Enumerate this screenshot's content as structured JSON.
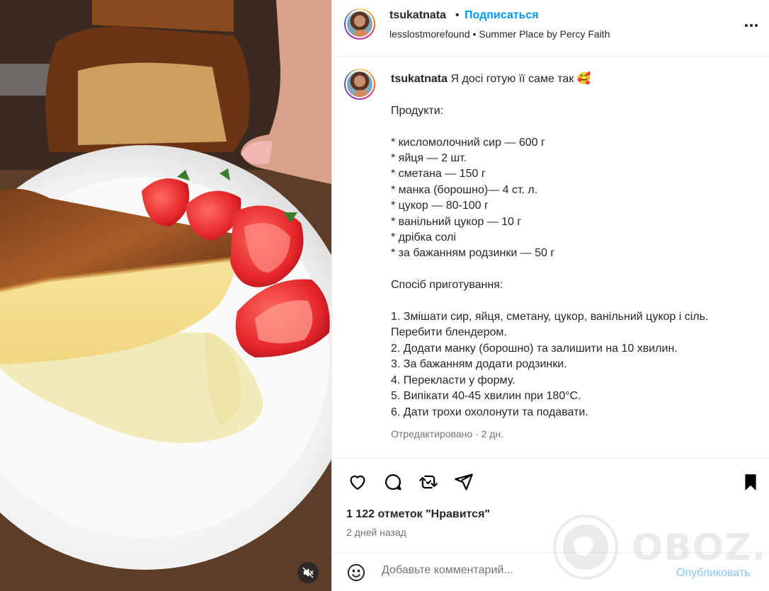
{
  "post": {
    "username": "tsukatnata",
    "separator": "•",
    "follow_label": "Подписаться",
    "location": "lesslostmorefound",
    "audio_separator": "•",
    "audio": "Summer Place by Percy Faith"
  },
  "caption": {
    "username": "tsukatnata",
    "lead": "Я досі готую її саме так 🥰",
    "body": "Продукти:\n\n* кисломолочний сир — 600 г\n* яйця — 2 шт.\n* сметана — 150 г\n* манка (борошно)— 4 ст. л.\n* цукор — 80-100 г\n* ванільний цукор — 10 г\n* дрібка солі\n* за бажанням родзинки — 50 г\n\nСпосіб приготування:\n\n1. Змішати сир, яйця, сметану, цукор, ванільний цукор і сіль. Перебити блендером.\n2. Додати манку (борошно) та залишити на 10 хвилин.\n3. За бажанням додати родзинки.\n4. Перекласти у форму.\n5. Випікати 40-45 хвилин при 180°С.\n6. Дати трохи охолонути та подавати.",
    "meta": "Отредактировано · 2 дн."
  },
  "actions": {
    "icons": [
      "heart-icon",
      "comment-icon",
      "repost-icon",
      "share-icon",
      "bookmark-icon"
    ],
    "likes": "1 122 отметок \"Нравится\"",
    "date": "2 дней назад"
  },
  "comment": {
    "placeholder": "Добавьте комментарий...",
    "publish_label": "Опубликовать"
  },
  "watermark": {
    "text": "OBOZ.UA"
  },
  "colors": {
    "link": "#0095f6",
    "publish_disabled": "#85c6f8",
    "muted": "#737373",
    "text": "#262626"
  }
}
